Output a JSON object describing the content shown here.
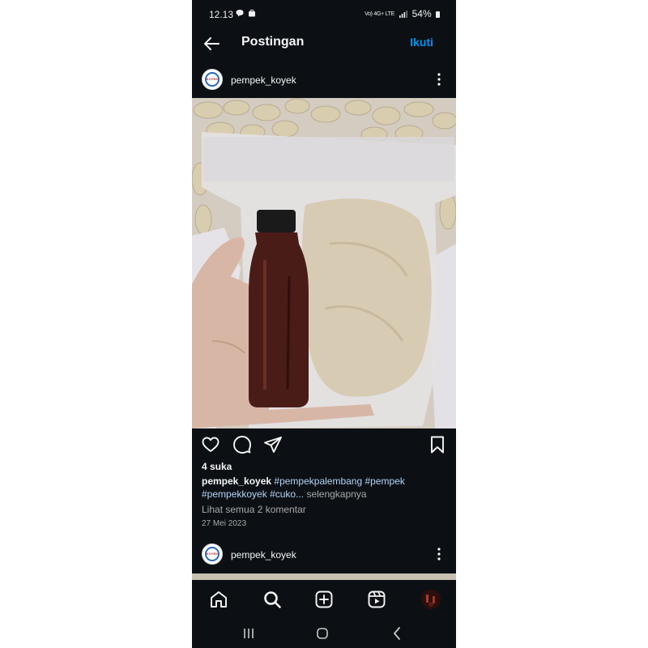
{
  "status_bar": {
    "time": "12.13",
    "notification_icons": [
      "chat-bubble-icon",
      "shopping-bag-icon"
    ],
    "network_label": "Vo) 4G+ LTE",
    "battery": "54%"
  },
  "top_bar": {
    "title": "Postingan",
    "follow_label": "Ikuti"
  },
  "post": {
    "username": "pempek_koyek",
    "avatar_text": "KOYEK",
    "likes": "4 suka",
    "caption": {
      "username": "pempek_koyek",
      "tag1": "#pempekpalembang",
      "tag2": "#pempek",
      "tag3": "#pempekkoyek",
      "tag4": "#cuko...",
      "more": "selengkapnya"
    },
    "comments_link": "Lihat semua 2 komentar",
    "date": "27 Mei 2023"
  },
  "next_post": {
    "username": "pempek_koyek",
    "avatar_text": "KOYEK"
  },
  "bottom_nav": [
    "home-icon",
    "search-icon",
    "create-post-icon",
    "reels-icon",
    "profile-avatar"
  ],
  "system_nav": [
    "recent-apps-icon",
    "home-circle-icon",
    "back-chevron-icon"
  ],
  "colors": {
    "background": "#0c1014",
    "accent": "#0095f6",
    "hashtag": "#b3d4f7",
    "muted_text": "#a8a8a8"
  }
}
